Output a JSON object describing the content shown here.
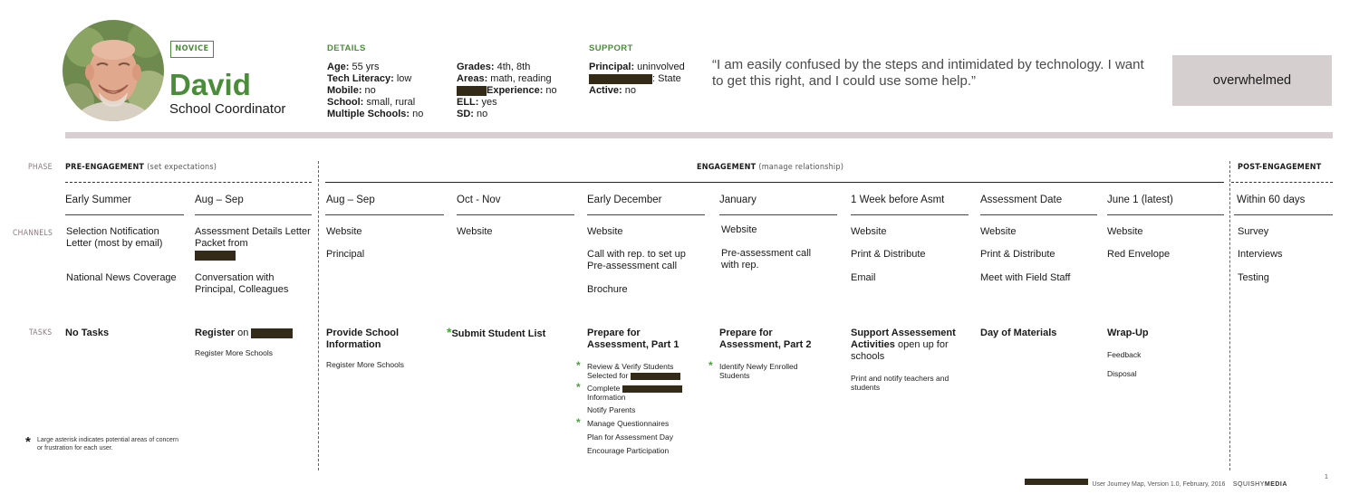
{
  "persona": {
    "level": "NOVICE",
    "name": "David",
    "role": "School Coordinator"
  },
  "details": {
    "heading": "DETAILS",
    "col1": [
      {
        "k": "Age:",
        "v": " 55 yrs"
      },
      {
        "k": "Tech Literacy:",
        "v": " low"
      },
      {
        "k": "Mobile:",
        "v": " no"
      },
      {
        "k": "School:",
        "v": " small, rural"
      },
      {
        "k": "Multiple Schools:",
        "v": " no"
      }
    ],
    "col2": [
      {
        "k": "Grades:",
        "v": " 4th, 8th"
      },
      {
        "k": "Areas:",
        "v": " math, reading"
      },
      {
        "k": "Experience:",
        "v": " no"
      },
      {
        "k": "ELL:",
        "v": " yes"
      },
      {
        "k": "SD:",
        "v": " no"
      }
    ]
  },
  "support": {
    "heading": "SUPPORT",
    "principal_k": "Principal:",
    "principal_v": " uninvolved",
    "state_v": ": State",
    "active_k": "Active:",
    "active_v": " no"
  },
  "quote": "“I am easily confused by the steps and intimidated by technology. I want to get this right, and I could use some help.”",
  "mood": "overwhelmed",
  "row_labels": {
    "phase": "PHASE",
    "channels": "CHANNELS",
    "tasks": "TASKS"
  },
  "phases": {
    "pre": {
      "title": "PRE-ENGAGEMENT",
      "note": "(set expectations)"
    },
    "eng": {
      "title": "ENGAGEMENT",
      "note": "(manage relationship)"
    },
    "post": {
      "title": "POST-ENGAGEMENT"
    }
  },
  "columns": [
    {
      "time": "Early Summer",
      "channels": [
        "Selection Notification Letter (most by email)",
        "National News Coverage"
      ],
      "task": "No Tasks",
      "subs": []
    },
    {
      "time": "Aug – Sep",
      "channels": [
        "Assessment Details Letter Packet from",
        "Conversation with Principal, Colleagues"
      ],
      "task": "Register",
      "task_n": " on",
      "subs": [
        "Register More Schools"
      ]
    },
    {
      "time": "Aug – Sep",
      "channels": [
        "Website",
        "Principal"
      ],
      "task": "Provide School Information",
      "subs": [
        "Register More Schools"
      ]
    },
    {
      "time": "Oct - Nov",
      "channels": [
        "Website"
      ],
      "task": "Submit Student List",
      "subs": []
    },
    {
      "time": "Early December",
      "channels": [
        "Website",
        "Call with rep. to set up Pre-assessment call",
        "Brochure"
      ],
      "task": "Prepare for Assessment, Part 1",
      "subs": [
        "Review & Verify Students Selected for",
        "Complete",
        "Information",
        "Notify Parents",
        "Manage Questionnaires",
        "Plan for Assessment Day",
        "Encourage Participation"
      ]
    },
    {
      "time": "January",
      "channels": [
        "Website",
        "Pre-assessment call with rep."
      ],
      "task": "Prepare for Assessment, Part 2",
      "subs": [
        "Identify Newly Enrolled Students"
      ]
    },
    {
      "time": "1 Week before Asmt",
      "channels": [
        "Website",
        "Print & Distribute",
        "Email"
      ],
      "task": "Support Assessement Activities",
      "task_n": " open up for schools",
      "subs": [
        "Print and notify teachers and students"
      ]
    },
    {
      "time": "Assessment Date",
      "channels": [
        "Website",
        "Print & Distribute",
        "Meet with Field Staff"
      ],
      "task": "Day of Materials",
      "subs": []
    },
    {
      "time": "June 1 (latest)",
      "channels": [
        "Website",
        "Red Envelope"
      ],
      "task": "Wrap-Up",
      "subs": [
        "Feedback",
        "Disposal"
      ]
    },
    {
      "time": "Within 60 days",
      "channels": [
        "Survey",
        "Interviews",
        "Testing"
      ],
      "task": "",
      "subs": []
    }
  ],
  "asterisk_symbol": "*",
  "legend_note": "Large asterisk indicates potential areas of concern or frustration for each user.",
  "footer": {
    "text": "User Journey Map, Version 1.0, February, 2016",
    "brand_a": "SQUISHY",
    "brand_b": "MEDIA",
    "page": "1"
  },
  "colors": {
    "accent_green": "#4a8c3a",
    "mood_bg": "#d6cfd0",
    "divider": "#d8cfd3",
    "redaction": "#332a18"
  }
}
